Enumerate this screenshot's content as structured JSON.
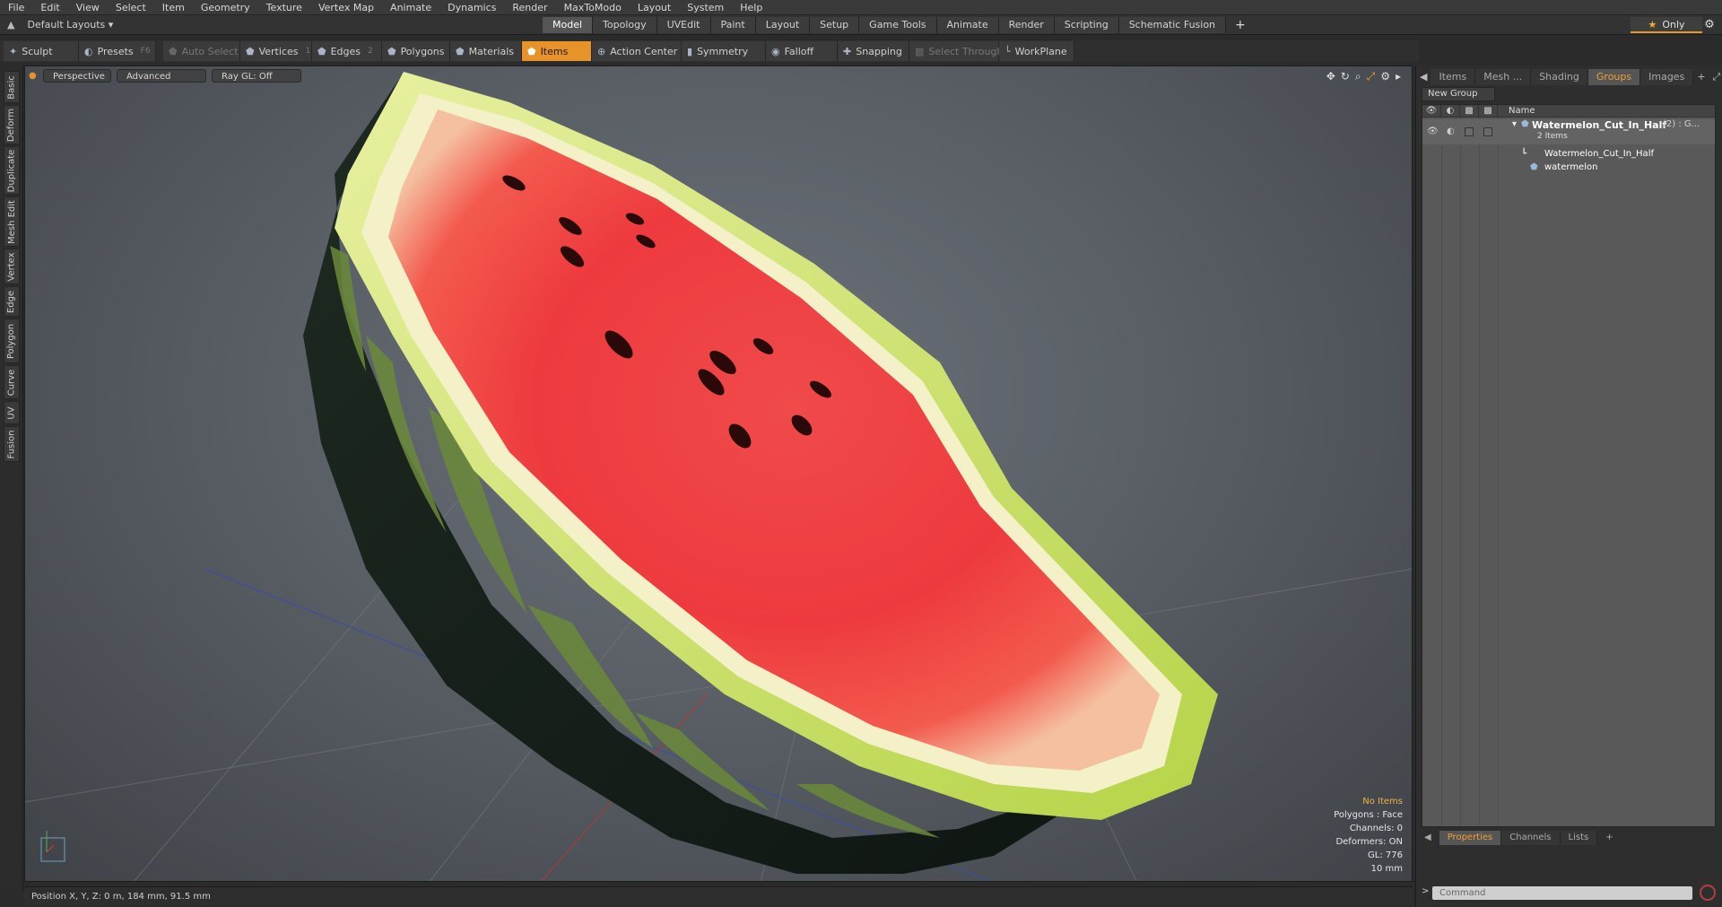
{
  "menu": [
    "File",
    "Edit",
    "View",
    "Select",
    "Item",
    "Geometry",
    "Texture",
    "Vertex Map",
    "Animate",
    "Dynamics",
    "Render",
    "MaxToModo",
    "Layout",
    "System",
    "Help"
  ],
  "layout": {
    "label": "Default Layouts ▾"
  },
  "tabs": [
    "Model",
    "Topology",
    "UVEdit",
    "Paint",
    "Layout",
    "Setup",
    "Game Tools",
    "Animate",
    "Render",
    "Scripting",
    "Schematic Fusion"
  ],
  "active_tab": "Model",
  "only_label": "Only",
  "toolbar": {
    "sculpt": "Sculpt",
    "presets": "Presets",
    "presets_key": "F6",
    "auto_select": "Auto Select",
    "vertices": "Vertices",
    "vertices_key": "1",
    "edges": "Edges",
    "edges_key": "2",
    "polygons": "Polygons",
    "materials": "Materials",
    "items": "Items",
    "action_center": "Action Center",
    "symmetry": "Symmetry",
    "falloff": "Falloff",
    "snapping": "Snapping",
    "select_through": "Select Through",
    "workplane": "WorkPlane"
  },
  "left_tabs": [
    "Basic",
    "Deform",
    "Duplicate",
    "Mesh Edit",
    "Vertex",
    "Edge",
    "Polygon",
    "Curve",
    "UV",
    "Fusion"
  ],
  "viewport": {
    "view": "Perspective",
    "shading": "Advanced",
    "raygl": "Ray GL: Off",
    "info": {
      "selection": "No Items",
      "polygons": "Polygons : Face",
      "channels": "Channels: 0",
      "deformers": "Deformers: ON",
      "gl": "GL: 776",
      "scale": "10 mm"
    }
  },
  "status": {
    "position": "Position X, Y, Z:  0 m, 184 mm, 91.5 mm"
  },
  "right_panel": {
    "tabs": [
      "Items",
      "Mesh ...",
      "Shading",
      "Groups",
      "Images"
    ],
    "active": "Groups",
    "new_group": "New Group",
    "column_name": "Name",
    "group_name": "Watermelon_Cut_In_Half",
    "group_count": "(2) : G...",
    "group_sub": "2 Items",
    "children": [
      "Watermelon_Cut_In_Half",
      "watermelon"
    ],
    "bottom_tabs": [
      "Properties",
      "Channels",
      "Lists"
    ],
    "bottom_active": "Properties",
    "command_placeholder": "Command"
  }
}
